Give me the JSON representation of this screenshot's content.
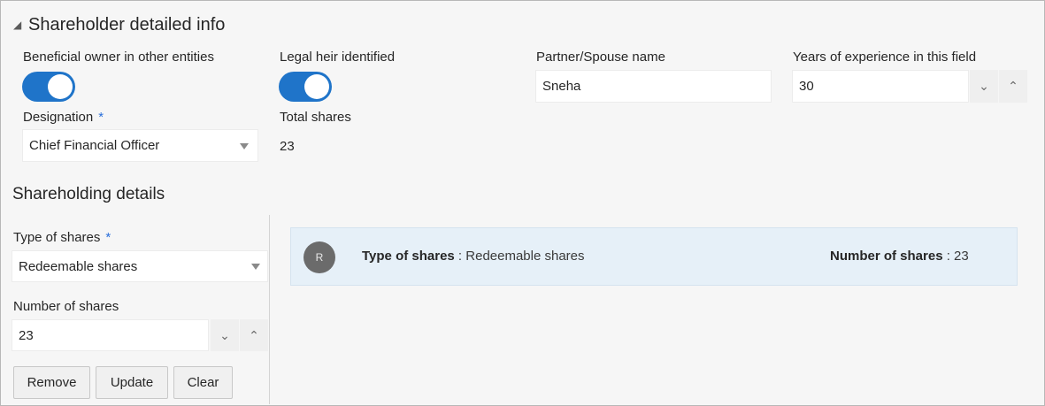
{
  "section": {
    "title": "Shareholder detailed info"
  },
  "fields": {
    "beneficial_owner_label": "Beneficial owner in other entities",
    "legal_heir_label": "Legal heir identified",
    "partner_label": "Partner/Spouse name",
    "partner_value": "Sneha",
    "experience_label": "Years of experience in this field",
    "experience_value": "30",
    "designation_label": "Designation",
    "designation_value": "Chief Financial Officer",
    "total_shares_label": "Total shares",
    "total_shares_value": "23",
    "required_mark": "*"
  },
  "shareholding": {
    "title": "Shareholding details",
    "type_label": "Type of shares",
    "type_value": "Redeemable shares",
    "number_label": "Number of shares",
    "number_value": "23",
    "buttons": {
      "remove": "Remove",
      "update": "Update",
      "clear": "Clear"
    }
  },
  "card": {
    "avatar": "R",
    "type_key": "Type of shares",
    "type_value": " : Redeemable shares",
    "number_key": "Number of shares",
    "number_value": " : 23"
  },
  "icons": {
    "collapse": "collapse-triangle-icon",
    "dropdown": "chevron-down-icon",
    "step_down": "chevron-down-icon",
    "step_up": "chevron-up-icon"
  },
  "colors": {
    "toggle_on": "#1f74c9",
    "required": "#2a6fdb",
    "card_background": "#e6f0f8"
  },
  "toggles": {
    "beneficial_owner": true,
    "legal_heir": true
  }
}
